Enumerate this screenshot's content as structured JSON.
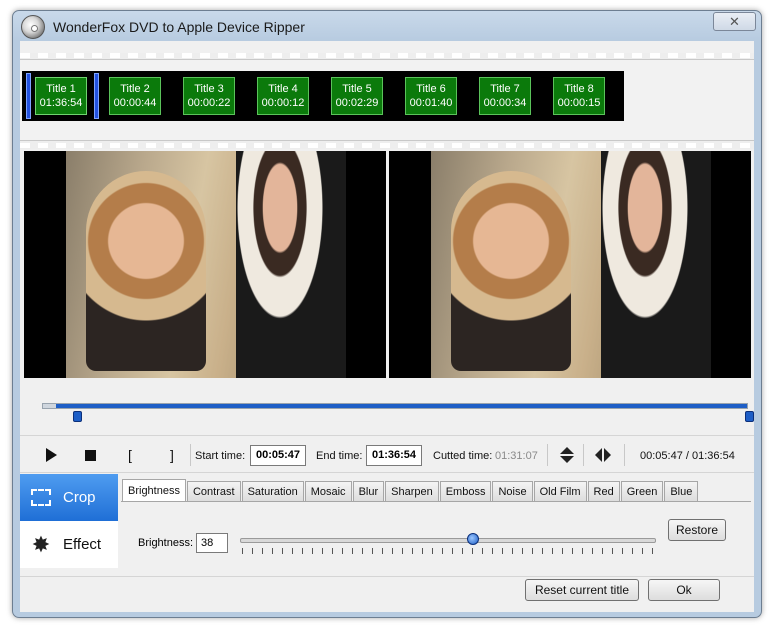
{
  "window": {
    "title": "WonderFox DVD to Apple Device Ripper",
    "close_glyph": "✕"
  },
  "titles": [
    {
      "name": "Title 1",
      "duration": "01:36:54",
      "selected": true
    },
    {
      "name": "Title 2",
      "duration": "00:00:44"
    },
    {
      "name": "Title 3",
      "duration": "00:00:22"
    },
    {
      "name": "Title 4",
      "duration": "00:00:12"
    },
    {
      "name": "Title 5",
      "duration": "00:02:29"
    },
    {
      "name": "Title 6",
      "duration": "00:01:40"
    },
    {
      "name": "Title 7",
      "duration": "00:00:34"
    },
    {
      "name": "Title 8",
      "duration": "00:00:15"
    }
  ],
  "timeline": {
    "start_fraction": 0.05,
    "end_fraction": 1.0
  },
  "controls": {
    "mark_in_glyph": "[",
    "mark_out_glyph": "]",
    "start_label": "Start time:",
    "start_value": "00:05:47",
    "end_label": "End time:",
    "end_value": "01:36:54",
    "cut_label": "Cutted time:",
    "cut_value": "01:31:07",
    "position": "00:05:47 / 01:36:54"
  },
  "modes": {
    "crop": "Crop",
    "effect": "Effect",
    "effect_glyph": "✸"
  },
  "effect_tabs": [
    "Brightness",
    "Contrast",
    "Saturation",
    "Mosaic",
    "Blur",
    "Sharpen",
    "Emboss",
    "Noise",
    "Old Film",
    "Red",
    "Green",
    "Blue"
  ],
  "active_tab": "Brightness",
  "brightness": {
    "label": "Brightness:",
    "value": "38",
    "slider_fraction": 0.56
  },
  "buttons": {
    "restore": "Restore",
    "reset": "Reset current title",
    "ok": "Ok"
  },
  "colors": {
    "accent": "#1d5ec6",
    "title_chip": "#0b7a0b"
  }
}
